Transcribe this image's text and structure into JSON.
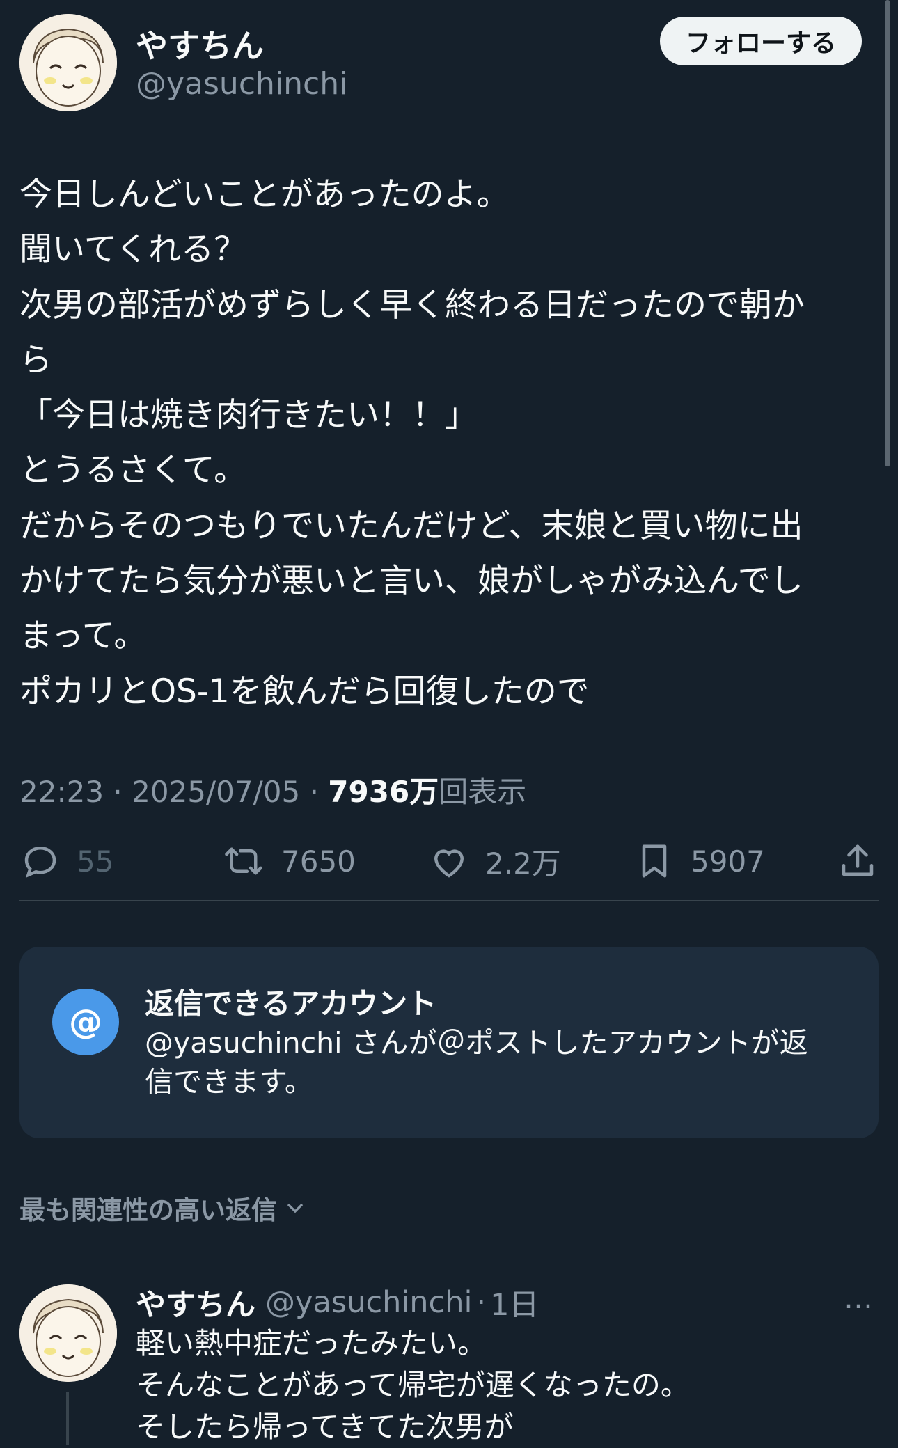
{
  "author": {
    "name": "やすちん",
    "handle": "@yasuchinchi",
    "avatar_icon": "avatar-illustration-icon"
  },
  "follow_button": "フォローする",
  "tweet": {
    "lines": [
      "今日しんどいことがあったのよ。",
      "聞いてくれる？",
      "次男の部活がめずらしく早く終わる日だったので朝か",
      "ら",
      "「今日は焼き肉行きたい！！」",
      "とうるさくて。",
      "だからそのつもりでいたんだけど、末娘と買い物に出",
      "かけてたら気分が悪いと言い、娘がしゃがみ込んでし",
      "まって。",
      "ポカリとOS-1を飲んだら回復したので"
    ],
    "time": "22:23",
    "date": "2025/07/05",
    "views_number": "7936万",
    "views_label": "回表示",
    "separator": "·"
  },
  "actions": {
    "reply_count": "55",
    "retweet_count": "7650",
    "like_count": "2.2万",
    "bookmark_count": "5907",
    "icons": [
      "reply-icon",
      "retweet-icon",
      "like-icon",
      "bookmark-icon",
      "share-icon"
    ]
  },
  "reply_restriction": {
    "icon_text": "@",
    "title": "返信できるアカウント",
    "text_line1": "@yasuchinchi さんが＠ポストしたアカウントが返",
    "text_line2": "信できます。"
  },
  "sort_label": "最も関連性の高い返信",
  "reply": {
    "name": "やすちん",
    "handle": "@yasuchinchi",
    "separator": "·",
    "time": "1日",
    "more_icon": "…",
    "lines": [
      "軽い熱中症だったみたい。",
      "そんなことがあって帰宅が遅くなったの。",
      "そしたら帰ってきてた次男が"
    ]
  },
  "colors": {
    "background": "#15202b",
    "text": "#f7f9f9",
    "secondary": "#8b98a5",
    "card": "#1e2d3d",
    "accent": "#4a99e9"
  }
}
